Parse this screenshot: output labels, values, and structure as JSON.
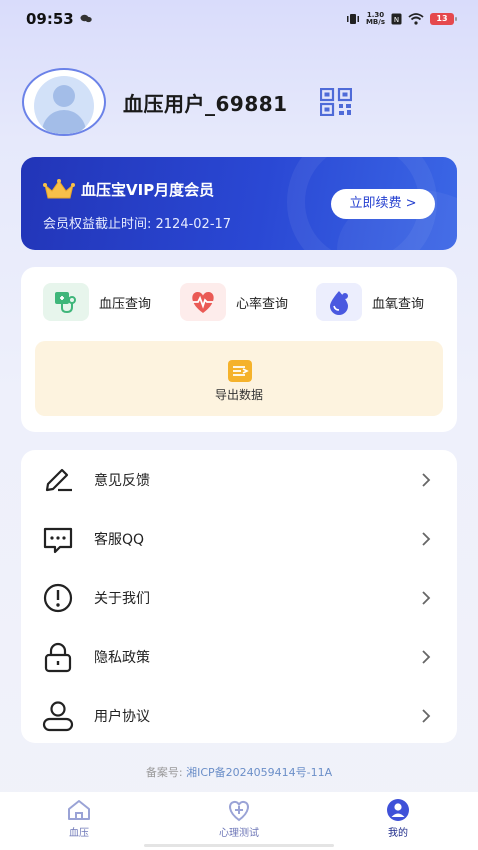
{
  "status_bar": {
    "time": "09:53",
    "net_speed_top": "1.30",
    "net_speed_bottom": "MB/s",
    "battery": "13"
  },
  "profile": {
    "username": "血压用户_69881"
  },
  "vip": {
    "title": "血压宝VIP月度会员",
    "expiry": "会员权益截止时间: 2124-02-17",
    "renew_label": "立即续费 >"
  },
  "functions": {
    "items": [
      {
        "label": "血压查询",
        "icon": "stethoscope-icon",
        "bg": "#e7f5ec",
        "color": "#3fb67a"
      },
      {
        "label": "心率查询",
        "icon": "heart-pulse-icon",
        "bg": "#fdeceb",
        "color": "#ea5a55"
      },
      {
        "label": "血氧查询",
        "icon": "blood-drop-icon",
        "bg": "#eceefd",
        "color": "#4a59e0"
      }
    ],
    "export_label": "导出数据"
  },
  "settings": {
    "items": [
      {
        "label": "意见反馈",
        "icon": "pen-icon"
      },
      {
        "label": "客服QQ",
        "icon": "message-icon"
      },
      {
        "label": "关于我们",
        "icon": "info-icon"
      },
      {
        "label": "隐私政策",
        "icon": "lock-icon"
      },
      {
        "label": "用户协议",
        "icon": "user-icon"
      }
    ]
  },
  "footer": {
    "icp_key": "备案号:",
    "icp_value": "湘ICP备2024059414号-11A"
  },
  "bottom_nav": {
    "items": [
      {
        "label": "血压",
        "icon": "home-icon",
        "active": false
      },
      {
        "label": "心理测试",
        "icon": "psych-test-icon",
        "active": false
      },
      {
        "label": "我的",
        "icon": "profile-icon",
        "active": true
      }
    ]
  },
  "colors": {
    "accent": "#2a48d4",
    "active_nav": "#3f51d8",
    "inactive_nav": "#9aa3d6"
  }
}
